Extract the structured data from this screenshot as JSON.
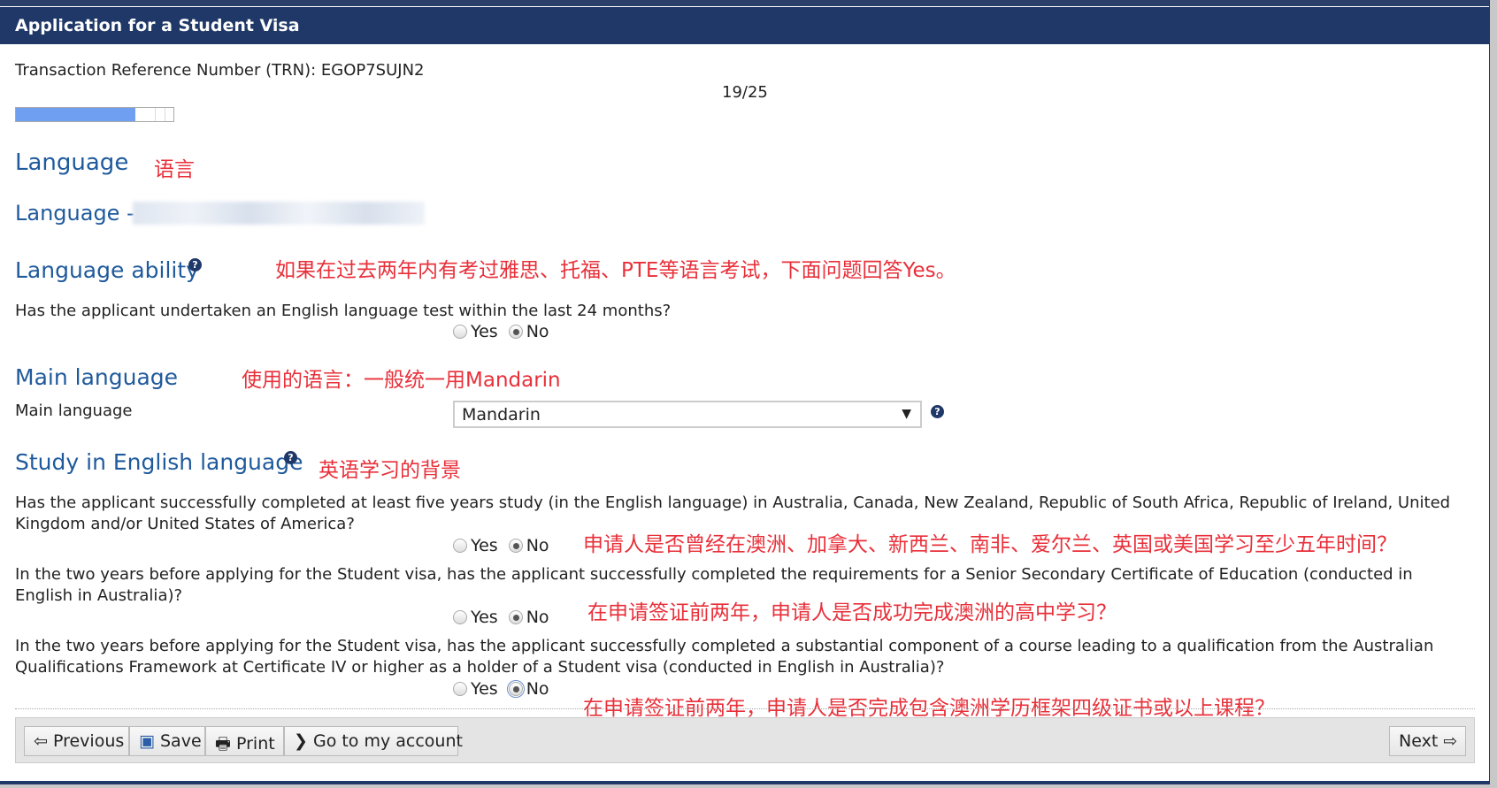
{
  "header": {
    "title": "Application for a Student Visa"
  },
  "trn": "Transaction Reference Number (TRN): EGOP7SUJN2",
  "progress": {
    "label": "19/25",
    "current": 19,
    "total": 25
  },
  "sections": {
    "language": {
      "title": "Language",
      "note": "语言"
    },
    "language_sub": {
      "title": "Language -"
    },
    "ability": {
      "title": "Language ability",
      "note": "如果在过去两年内有考过雅思、托福、PTE等语言考试，下面问题回答Yes。",
      "question": "Has the applicant undertaken an English language test within the last 24 months?",
      "answer": "No"
    },
    "main": {
      "title": "Main language",
      "note": "使用的语言：一般统一用Mandarin",
      "label": "Main language",
      "value": "Mandarin"
    },
    "study": {
      "title": "Study in English language",
      "note": "英语学习的背景",
      "questions": [
        {
          "text": "Has the applicant successfully completed at least five years study (in the English language) in Australia, Canada, New Zealand, Republic of South Africa, Republic of Ireland, United Kingdom and/or United States of America?",
          "answer": "No",
          "note": "申请人是否曾经在澳洲、加拿大、新西兰、南非、爱尔兰、英国或美国学习至少五年时间？"
        },
        {
          "text": "In the two years before applying for the Student visa, has the applicant successfully completed the requirements for a Senior Secondary Certificate of Education (conducted in English in Australia)?",
          "answer": "No",
          "note": "在申请签证前两年，申请人是否成功完成澳洲的高中学习？"
        },
        {
          "text": "In the two years before applying for the Student visa, has the applicant successfully completed a substantial component of a course leading to a qualification from the Australian Qualifications Framework at Certificate IV or higher as a holder of a Student visa (conducted in English in Australia)?",
          "answer": "No",
          "note": "在申请签证前两年，申请人是否完成包含澳洲学历框架四级证书或以上课程？"
        }
      ]
    }
  },
  "radio": {
    "yes": "Yes",
    "no": "No"
  },
  "help": "?",
  "buttons": {
    "previous": "Previous",
    "save": "Save",
    "print": "Print",
    "account": "Go to my account",
    "next": "Next"
  },
  "colors": {
    "header": "#1f3868",
    "heading": "#1f5a9c",
    "annotation": "#e8303a",
    "progress": "#6f9ff0"
  }
}
